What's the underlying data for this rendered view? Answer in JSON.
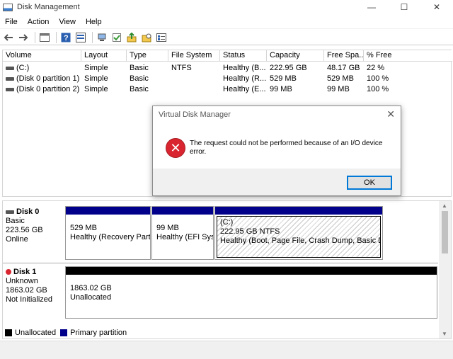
{
  "window": {
    "title": "Disk Management",
    "minimize": "—",
    "maximize": "☐",
    "close": "✕"
  },
  "menu": [
    "File",
    "Action",
    "View",
    "Help"
  ],
  "volume_table": {
    "columns": [
      "Volume",
      "Layout",
      "Type",
      "File System",
      "Status",
      "Capacity",
      "Free Spa...",
      "% Free"
    ],
    "rows": [
      [
        "(C:)",
        "Simple",
        "Basic",
        "NTFS",
        "Healthy (B...",
        "222.95 GB",
        "48.17 GB",
        "22 %"
      ],
      [
        "(Disk 0 partition 1)",
        "Simple",
        "Basic",
        "",
        "Healthy (R...",
        "529 MB",
        "529 MB",
        "100 %"
      ],
      [
        "(Disk 0 partition 2)",
        "Simple",
        "Basic",
        "",
        "Healthy (E...",
        "99 MB",
        "99 MB",
        "100 %"
      ]
    ]
  },
  "disks": [
    {
      "name": "Disk 0",
      "type": "Basic",
      "size": "223.56 GB",
      "state": "Online",
      "partitions": [
        {
          "size": "529 MB",
          "status": "Healthy (Recovery Partit"
        },
        {
          "size": "99 MB",
          "status": "Healthy (EFI Syst"
        },
        {
          "label": "(C:)",
          "size": "222.95 GB NTFS",
          "status": "Healthy (Boot, Page File, Crash Dump, Basic Data P"
        }
      ]
    },
    {
      "name": "Disk 1",
      "type": "Unknown",
      "size": "1863.02 GB",
      "state": "Not Initialized",
      "partitions": [
        {
          "size": "1863.02 GB",
          "status": "Unallocated"
        }
      ]
    }
  ],
  "legend": {
    "unallocated": "Unallocated",
    "primary": "Primary partition"
  },
  "colors": {
    "primary": "#00008b",
    "unallocated": "#000000",
    "error": "#d9252f",
    "accent": "#0078d7"
  },
  "dialog": {
    "title": "Virtual Disk Manager",
    "close": "✕",
    "message": "The request could not be performed because of an I/O device error.",
    "ok": "OK",
    "icon": "error-icon"
  }
}
